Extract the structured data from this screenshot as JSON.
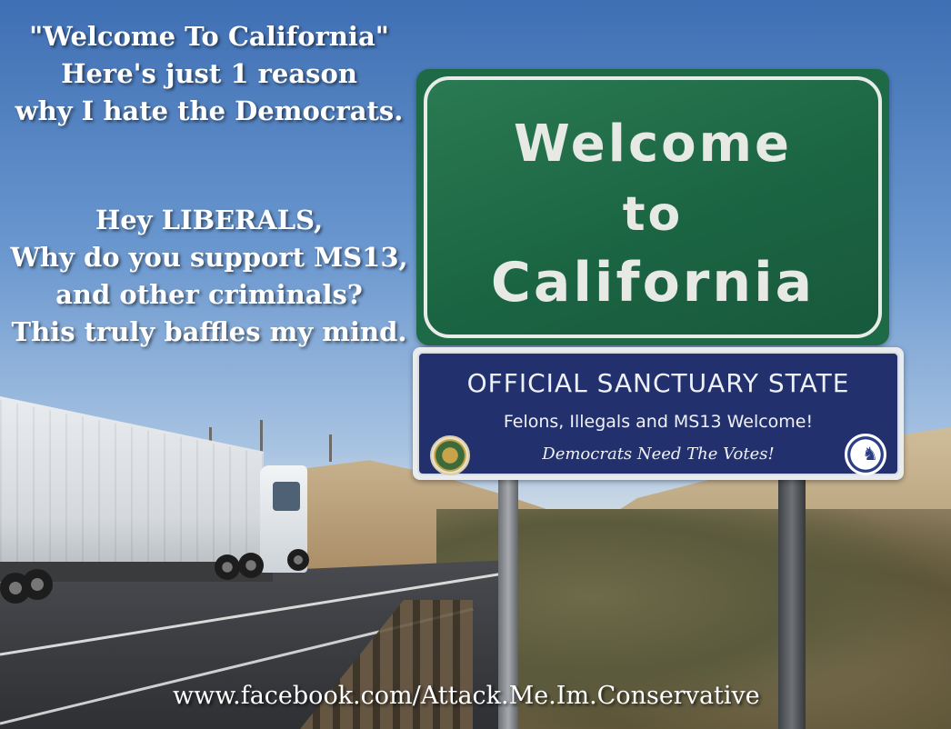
{
  "headline_lines": [
    "\"Welcome To California\"",
    "Here's just 1 reason",
    "why I hate the Democrats."
  ],
  "question_lines": [
    "Hey LIBERALS,",
    "Why do you support MS13,",
    "and other criminals?",
    "This truly baffles my mind."
  ],
  "green_sign": {
    "line1": "Welcome",
    "line2": "to",
    "line3": "California"
  },
  "blue_sign": {
    "title": "OFFICIAL SANCTUARY STATE",
    "subtitle": "Felons, Illegals and MS13 Welcome!",
    "tagline": "Democrats Need The Votes!"
  },
  "footer_url": "www.facebook.com/Attack.Me.Im.Conservative",
  "colors": {
    "green_sign": "#1f6a46",
    "blue_sign": "#23306e",
    "text": "#ffffff"
  }
}
